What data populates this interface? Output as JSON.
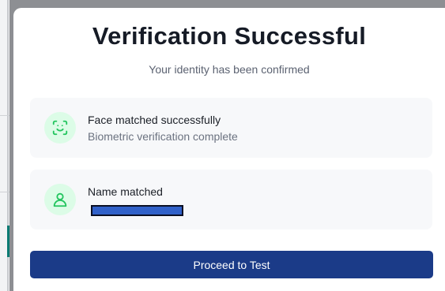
{
  "modal": {
    "title": "Verification Successful",
    "subtitle": "Your identity has been confirmed"
  },
  "checks": [
    {
      "icon": "face-scan-icon",
      "title": "Face matched successfully",
      "subtitle": "Biometric verification complete"
    },
    {
      "icon": "user-icon",
      "title": "Name matched"
    }
  ],
  "actions": {
    "proceed_label": "Proceed to Test"
  },
  "colors": {
    "primary_button": "#1b3b88",
    "success_icon": "#22c55e",
    "success_icon_bg": "#dcfce7",
    "card_bg": "#f7f8fa",
    "redaction": "#3161c9"
  }
}
